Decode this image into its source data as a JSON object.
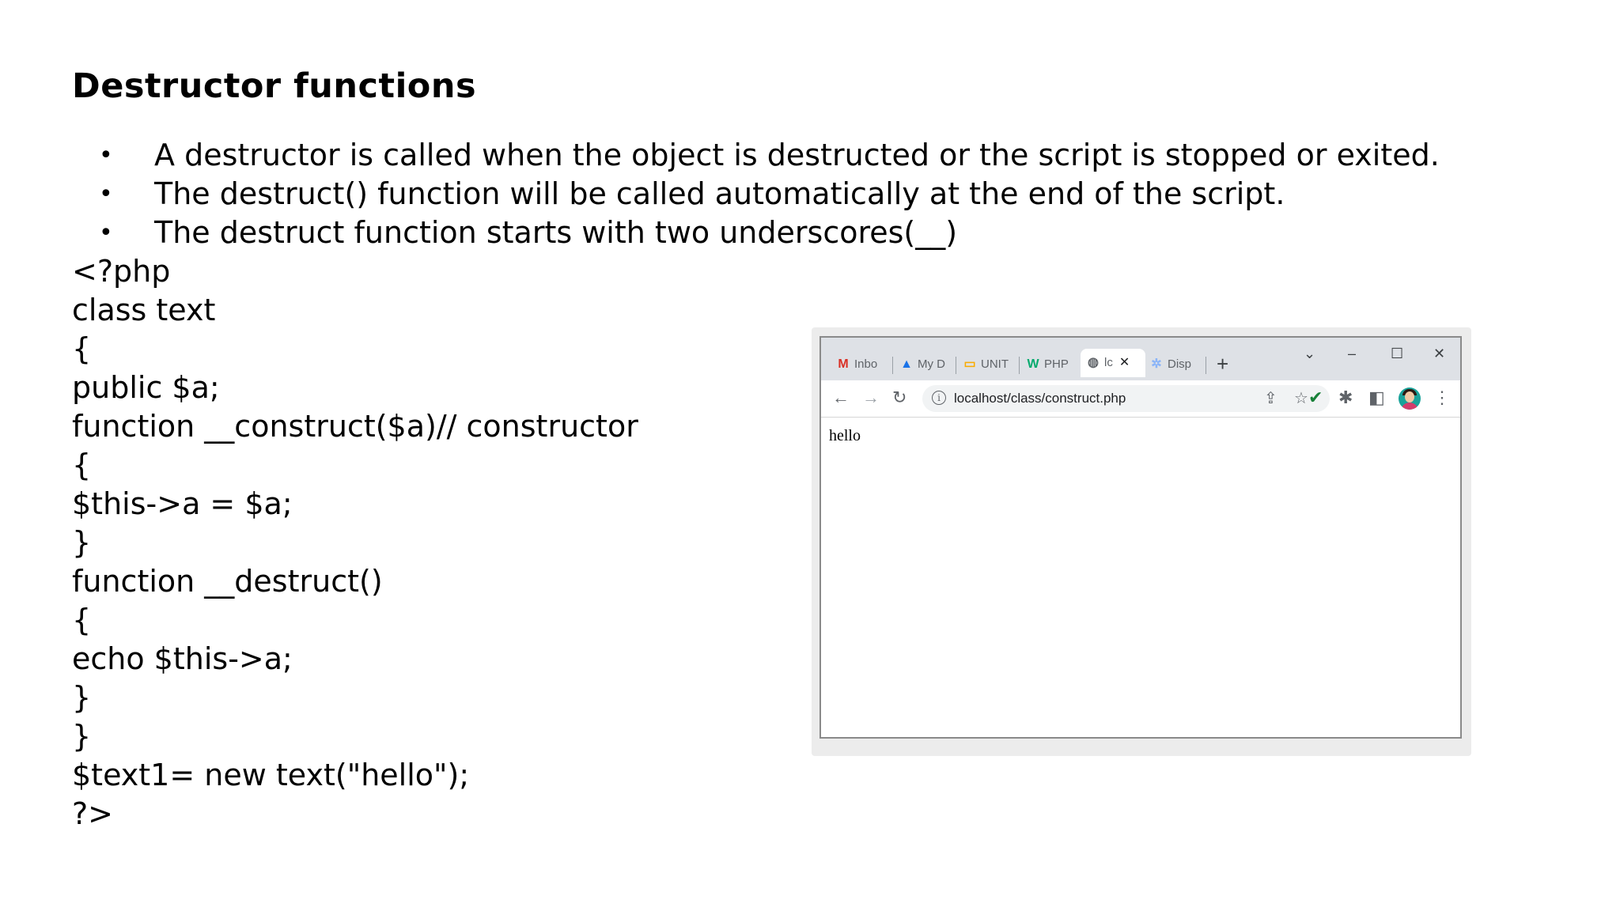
{
  "slide": {
    "title": "Destructor functions",
    "bullets": [
      "A destructor is called when the object is destructed or the script is stopped or exited.",
      "The destruct() function will be called automatically at the end of the script.",
      "The destruct function starts with two underscores(__)"
    ],
    "bullet_symbol": "•",
    "code_lines": [
      "<?php",
      "class text",
      "{",
      "public $a;",
      "function __construct($a)// constructor",
      "{",
      "$this->a = $a;",
      "}",
      "function __destruct()",
      "{",
      "echo $this->a;",
      "}",
      "}",
      "$text1= new text(\"hello\");",
      "?>"
    ]
  },
  "browser": {
    "tabs": [
      {
        "label": "Inbo",
        "icon": "gmail-icon",
        "glyph": "M",
        "color": "#d93025"
      },
      {
        "label": "My D",
        "icon": "google-drive-icon",
        "glyph": "▲",
        "color": "#1a73e8"
      },
      {
        "label": "UNIT",
        "icon": "google-slides-icon",
        "glyph": "▭",
        "color": "#f9ab00"
      },
      {
        "label": "PHP",
        "icon": "w3schools-icon",
        "glyph": "W",
        "color": "#04aa6d"
      },
      {
        "label": "lc",
        "icon": "globe-icon",
        "glyph": "◍",
        "color": "#5f6368",
        "active": true
      },
      {
        "label": "Disp",
        "icon": "loading-icon",
        "glyph": "✲",
        "color": "#8ab4f8"
      }
    ],
    "new_tab_symbol": "+",
    "tab_close_symbol": "✕",
    "window_controls": {
      "tab_search": "⌄",
      "minimize": "–",
      "maximize": "☐",
      "close": "✕"
    },
    "nav": {
      "back": "←",
      "forward": "→",
      "reload": "↻"
    },
    "address": {
      "url": "localhost/class/construct.php",
      "info_symbol": "i"
    },
    "omnibox_icons": {
      "share": "⇪",
      "bookmark": "☆"
    },
    "extensions": {
      "check": "✔",
      "puzzle": "✱",
      "sidepanel": "◧",
      "menu": "⋮"
    },
    "colors": {
      "check": "#188038",
      "tabbar": "#dee1e6"
    },
    "page_output": "hello"
  }
}
